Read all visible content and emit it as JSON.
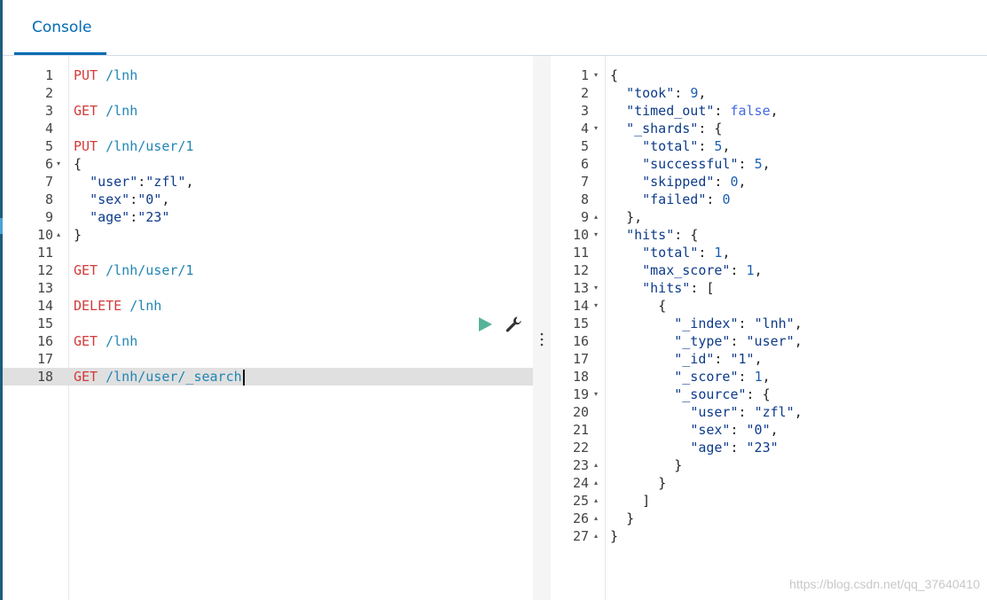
{
  "header": {
    "tab_console": "Console"
  },
  "request_editor": {
    "lines": [
      {
        "n": "1",
        "method": "PUT",
        "url": "/lnh"
      },
      {
        "n": "2"
      },
      {
        "n": "3",
        "method": "GET",
        "url": "/lnh"
      },
      {
        "n": "4"
      },
      {
        "n": "5",
        "method": "PUT",
        "url": "/lnh/user/1"
      },
      {
        "n": "6",
        "fold": "▾",
        "text": "{"
      },
      {
        "n": "7",
        "text": "  \"user\":\"zfl\","
      },
      {
        "n": "8",
        "text": "  \"sex\":\"0\","
      },
      {
        "n": "9",
        "text": "  \"age\":\"23\""
      },
      {
        "n": "10",
        "fold": "▴",
        "text": "}"
      },
      {
        "n": "11"
      },
      {
        "n": "12",
        "method": "GET",
        "url": "/lnh/user/1"
      },
      {
        "n": "13"
      },
      {
        "n": "14",
        "method": "DELETE",
        "url": "/lnh"
      },
      {
        "n": "15"
      },
      {
        "n": "16",
        "method": "GET",
        "url": "/lnh"
      },
      {
        "n": "17"
      },
      {
        "n": "18",
        "method": "GET",
        "url": "/lnh/user/_search",
        "active": true
      }
    ]
  },
  "response_viewer": {
    "lines": [
      {
        "n": "1",
        "fold": "▾",
        "text": "{"
      },
      {
        "n": "2",
        "text": "  \"took\": 9,"
      },
      {
        "n": "3",
        "text": "  \"timed_out\": false,"
      },
      {
        "n": "4",
        "fold": "▾",
        "text": "  \"_shards\": {"
      },
      {
        "n": "5",
        "text": "    \"total\": 5,"
      },
      {
        "n": "6",
        "text": "    \"successful\": 5,"
      },
      {
        "n": "7",
        "text": "    \"skipped\": 0,"
      },
      {
        "n": "8",
        "text": "    \"failed\": 0"
      },
      {
        "n": "9",
        "fold": "▴",
        "text": "  },"
      },
      {
        "n": "10",
        "fold": "▾",
        "text": "  \"hits\": {"
      },
      {
        "n": "11",
        "text": "    \"total\": 1,"
      },
      {
        "n": "12",
        "text": "    \"max_score\": 1,"
      },
      {
        "n": "13",
        "fold": "▾",
        "text": "    \"hits\": ["
      },
      {
        "n": "14",
        "fold": "▾",
        "text": "      {"
      },
      {
        "n": "15",
        "text": "        \"_index\": \"lnh\","
      },
      {
        "n": "16",
        "text": "        \"_type\": \"user\","
      },
      {
        "n": "17",
        "text": "        \"_id\": \"1\","
      },
      {
        "n": "18",
        "text": "        \"_score\": 1,"
      },
      {
        "n": "19",
        "fold": "▾",
        "text": "        \"_source\": {"
      },
      {
        "n": "20",
        "text": "          \"user\": \"zfl\","
      },
      {
        "n": "21",
        "text": "          \"sex\": \"0\","
      },
      {
        "n": "22",
        "text": "          \"age\": \"23\""
      },
      {
        "n": "23",
        "fold": "▴",
        "text": "        }"
      },
      {
        "n": "24",
        "fold": "▴",
        "text": "      }"
      },
      {
        "n": "25",
        "fold": "▴",
        "text": "    ]"
      },
      {
        "n": "26",
        "fold": "▴",
        "text": "  }"
      },
      {
        "n": "27",
        "fold": "▴",
        "text": "}"
      }
    ]
  },
  "icons": {
    "run": "play-icon",
    "settings": "wrench-icon",
    "splitter": "vertical-dots-icon"
  },
  "watermark": "https://blog.csdn.net/qq_37640410",
  "colors": {
    "accent": "#006bb4",
    "method": "#d43a3a",
    "url": "#2185b4",
    "run": "#54b399"
  }
}
